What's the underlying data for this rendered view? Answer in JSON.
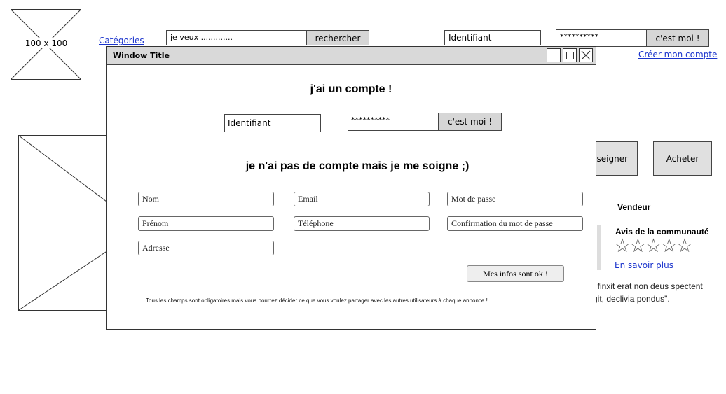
{
  "header": {
    "logo_label": "100 x 100",
    "categories_link": "Catégories",
    "search_value": "je veux .............",
    "search_button": "rechercher",
    "login_value": "Identifiant",
    "password_value": "**********",
    "login_button": "c'est moi !",
    "create_account_link": "Créer mon compte"
  },
  "background": {
    "renseigner_button": "nseigner",
    "acheter_button": "Acheter",
    "vendeur_label": "Vendeur",
    "avis_title": "Avis de la communauté",
    "stars": "☆☆☆☆☆",
    "en_savoir_plus": "En savoir plus",
    "quote_line1": "t finxit erat non deus spectent",
    "quote_line2": "git, declivia pondus\"."
  },
  "dialog": {
    "title": "Window Title",
    "has_account_heading": "j'ai un compte !",
    "login_value": "Identifiant",
    "password_value": "**********",
    "login_button": "c'est moi !",
    "no_account_heading": "je n'ai pas de compte mais je me soigne ;)",
    "fields": {
      "nom": "Nom",
      "email": "Email",
      "mot_de_passe": "Mot de passe",
      "prenom": "Prénom",
      "telephone": "Téléphone",
      "confirmation": "Confirmation du mot de passe",
      "adresse": "Adresse"
    },
    "submit_button": "Mes infos sont ok !",
    "footer_note": "Tous les champs sont obligatoires mais vous pourrez décider ce que vous voulez partager avec les autres utilisateurs à chaque annonce !"
  }
}
